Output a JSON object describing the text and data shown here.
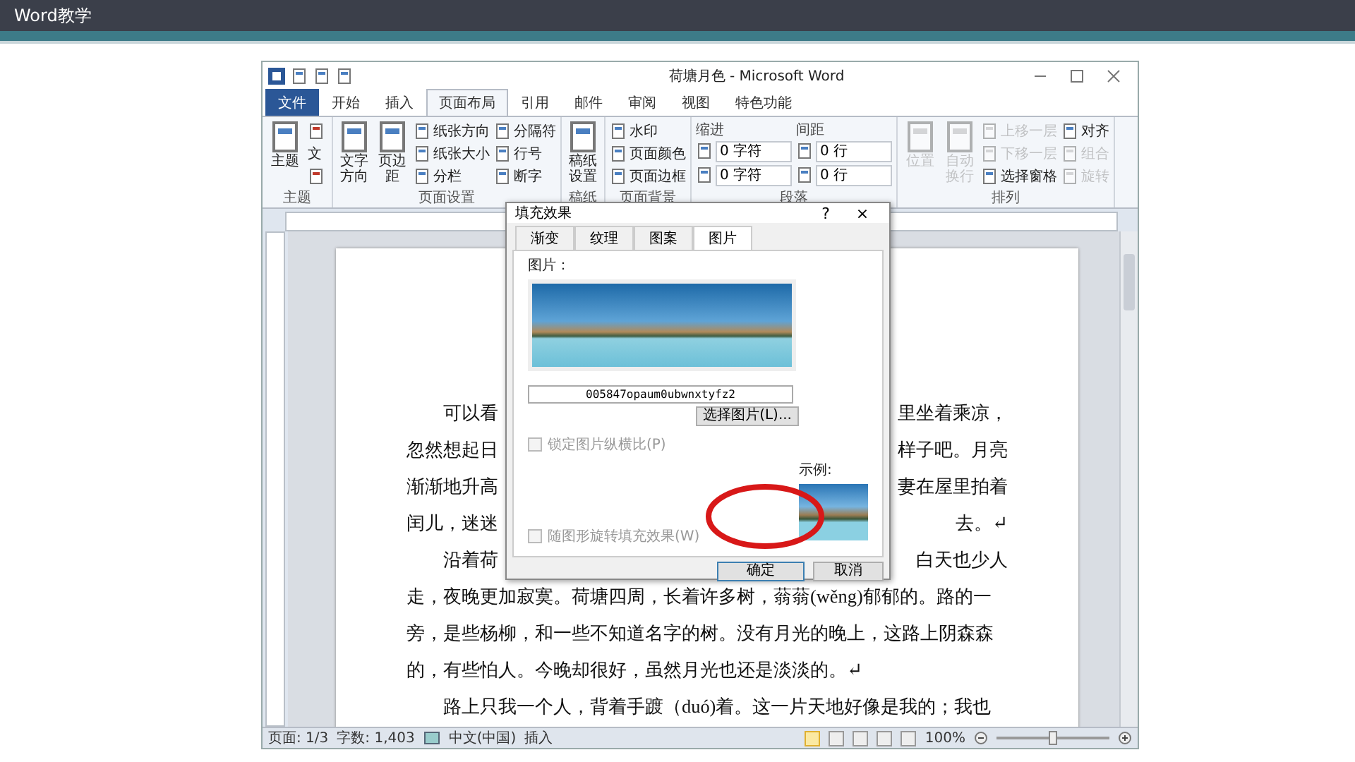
{
  "slide": {
    "title": "Word教学"
  },
  "window": {
    "title": "荷塘月色 - Microsoft Word"
  },
  "ribbon_tabs": [
    {
      "label": "文件",
      "kind": "file",
      "selected": false
    },
    {
      "label": "开始",
      "kind": "tab",
      "selected": false
    },
    {
      "label": "插入",
      "kind": "tab",
      "selected": false
    },
    {
      "label": "页面布局",
      "kind": "tab",
      "selected": true
    },
    {
      "label": "引用",
      "kind": "tab",
      "selected": false
    },
    {
      "label": "邮件",
      "kind": "tab",
      "selected": false
    },
    {
      "label": "审阅",
      "kind": "tab",
      "selected": false
    },
    {
      "label": "视图",
      "kind": "tab",
      "selected": false
    },
    {
      "label": "特色功能",
      "kind": "tab",
      "selected": false
    }
  ],
  "ribbon_groups": [
    {
      "title": "主题",
      "columns": [
        [
          {
            "kind": "large",
            "label": "主题",
            "disabled": false
          }
        ],
        [
          {
            "kind": "icon",
            "disabled": false
          },
          {
            "kind": "icon",
            "label": "文",
            "disabled": false
          },
          {
            "kind": "icon",
            "disabled": false
          }
        ]
      ]
    },
    {
      "title": "页面设置",
      "columns": [
        [
          {
            "kind": "large",
            "label": "文字方向",
            "disabled": false
          }
        ],
        [
          {
            "kind": "large",
            "label": "页边距",
            "disabled": false
          }
        ],
        [
          {
            "kind": "small",
            "label": "纸张方向",
            "disabled": false
          },
          {
            "kind": "small",
            "label": "纸张大小",
            "disabled": false
          },
          {
            "kind": "small",
            "label": "分栏",
            "disabled": false
          }
        ],
        [
          {
            "kind": "small",
            "label": "分隔符",
            "disabled": false
          },
          {
            "kind": "small",
            "label": "行号",
            "disabled": false
          },
          {
            "kind": "small",
            "label": "断字",
            "disabled": false
          }
        ]
      ]
    },
    {
      "title": "稿纸",
      "columns": [
        [
          {
            "kind": "large",
            "label": "稿纸设置",
            "disabled": false
          }
        ]
      ]
    },
    {
      "title": "页面背景",
      "columns": [
        [
          {
            "kind": "small",
            "label": "水印",
            "disabled": false
          },
          {
            "kind": "small",
            "label": "页面颜色",
            "disabled": false
          },
          {
            "kind": "small",
            "label": "页面边框",
            "disabled": false
          }
        ]
      ]
    },
    {
      "title": "段落",
      "columns": [
        [
          {
            "kind": "caption",
            "label": "缩进"
          },
          {
            "kind": "spin",
            "value": "0 字符"
          },
          {
            "kind": "spin",
            "value": "0 字符"
          }
        ],
        [
          {
            "kind": "caption",
            "label": "间距"
          },
          {
            "kind": "spin",
            "value": "0 行"
          },
          {
            "kind": "spin",
            "value": "0 行"
          }
        ]
      ]
    },
    {
      "title": "排列",
      "columns": [
        [
          {
            "kind": "large",
            "label": "位置",
            "disabled": true
          }
        ],
        [
          {
            "kind": "large",
            "label": "自动换行",
            "disabled": true
          }
        ],
        [
          {
            "kind": "small",
            "label": "上移一层",
            "disabled": true
          },
          {
            "kind": "small",
            "label": "下移一层",
            "disabled": true
          },
          {
            "kind": "small",
            "label": "选择窗格",
            "disabled": false
          }
        ],
        [
          {
            "kind": "small",
            "label": "对齐",
            "disabled": false
          },
          {
            "kind": "small",
            "label": "组合",
            "disabled": true
          },
          {
            "kind": "small",
            "label": "旋转",
            "disabled": true
          }
        ]
      ]
    }
  ],
  "document": {
    "paragraphs": [
      {
        "lines": [
          {
            "left": "可以看",
            "right": "里坐着乘凉，"
          },
          {
            "left": "忽然想起日",
            "right": "样子吧。月亮"
          },
          {
            "left": "渐渐地升高",
            "right": "妻在屋里拍着"
          },
          {
            "left": "闰儿，迷迷",
            "right": "去。↵"
          }
        ]
      },
      {
        "lines": [
          {
            "left": "沿着荷",
            "right": "白天也少人"
          },
          {
            "left": "走，夜晚更加寂寞。荷塘四周，长着许多树，蓊蓊(wěng)郁郁的。路的一"
          },
          {
            "left": "旁，是些杨柳，和一些不知道名字的树。没有月光的晚上，这路上阴森森"
          },
          {
            "left": "的，有些怕人。今晚却很好，虽然月光也还是淡淡的。↵"
          }
        ]
      },
      {
        "lines": [
          {
            "left": "路上只我一个人，背着手踱（duó)着。这一片天地好像是我的；我也"
          }
        ]
      }
    ]
  },
  "dialog": {
    "title": "填充效果",
    "help": "?",
    "close": "×",
    "tabs": [
      {
        "label": "渐变",
        "selected": false
      },
      {
        "label": "纹理",
        "selected": false
      },
      {
        "label": "图案",
        "selected": false
      },
      {
        "label": "图片",
        "selected": true
      }
    ],
    "picture_label": "图片：",
    "filename": "005847opaum0ubwnxtyfz2",
    "select_button": "选择图片(L)...",
    "checkboxes": [
      {
        "label": "锁定图片纵横比(P)",
        "checked": false,
        "disabled": true
      },
      {
        "label": "随图形旋转填充效果(W)",
        "checked": false,
        "disabled": true
      }
    ],
    "sample_label": "示例:",
    "buttons": [
      {
        "label": "确定",
        "default": true
      },
      {
        "label": "取消",
        "default": false
      }
    ]
  },
  "status_bar": {
    "items": [
      "页面: 1/3",
      "字数: 1,403",
      "中文(中国)",
      "插入"
    ],
    "views": [
      {
        "selected": true
      },
      {
        "selected": false
      },
      {
        "selected": false
      },
      {
        "selected": false
      },
      {
        "selected": false
      }
    ],
    "zoom": {
      "label": "100%",
      "level": 0.5
    }
  }
}
